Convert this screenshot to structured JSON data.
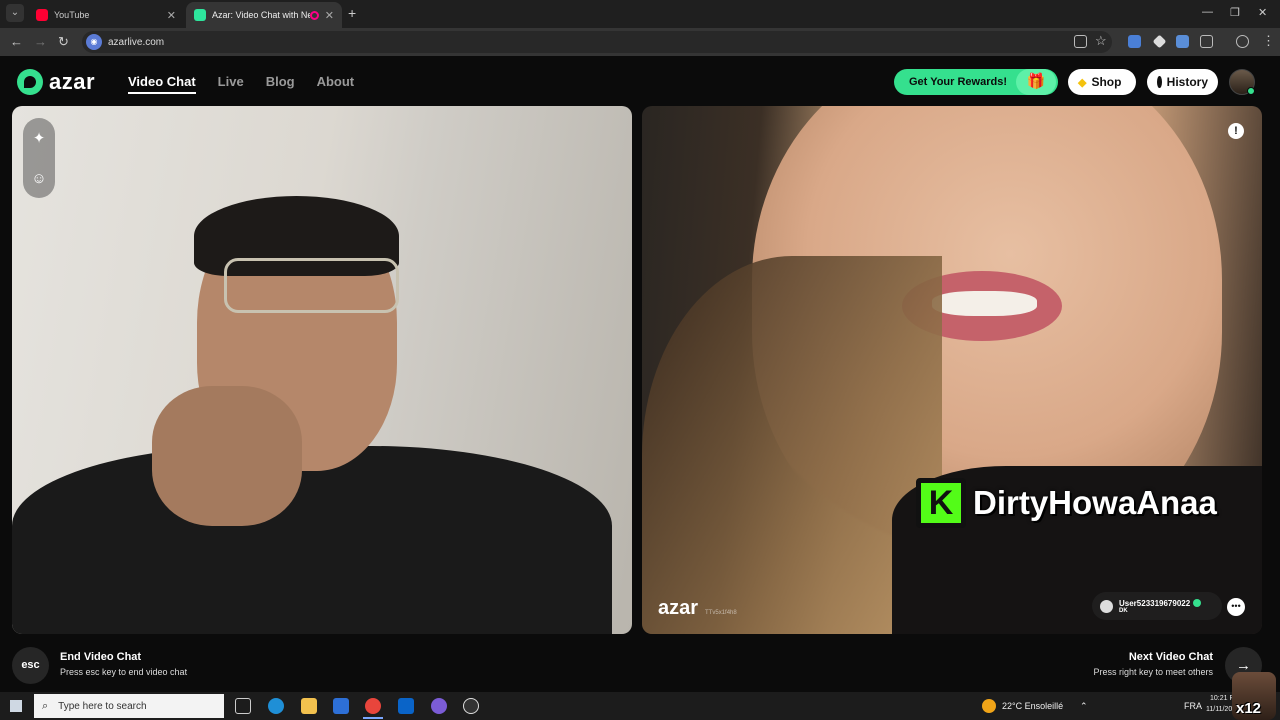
{
  "browser": {
    "tabs": [
      {
        "label": "YouTube",
        "active": false
      },
      {
        "label": "Azar: Video Chat with New",
        "active": true
      }
    ],
    "url": "azarlive.com"
  },
  "header": {
    "logo": "azar",
    "nav": [
      {
        "label": "Video Chat",
        "active": true
      },
      {
        "label": "Live",
        "active": false
      },
      {
        "label": "Blog",
        "active": false
      },
      {
        "label": "About",
        "active": false
      }
    ],
    "rewards_label": "Get Your Rewards!",
    "shop_label": "Shop",
    "history_label": "History"
  },
  "remote": {
    "overlay_text": "DirtyHowaAnaa",
    "watermark": "azar",
    "watermark_code": "TTv5x1f4h8",
    "username": "User523319679022",
    "country": "DK"
  },
  "controls": {
    "esc_key": "esc",
    "end_title": "End Video Chat",
    "end_subtitle": "Press esc key to end video chat",
    "next_title": "Next Video Chat",
    "next_subtitle": "Press right key to meet others"
  },
  "taskbar": {
    "search_placeholder": "Type here to search",
    "weather": "22°C  Ensoleillé",
    "language": "FRA",
    "time": "10:21 P",
    "date": "11/11/20",
    "corner_label": "x12"
  },
  "colors": {
    "accent": "#35e08e",
    "background": "#0b0b0b",
    "kick_green": "#53fc18"
  }
}
